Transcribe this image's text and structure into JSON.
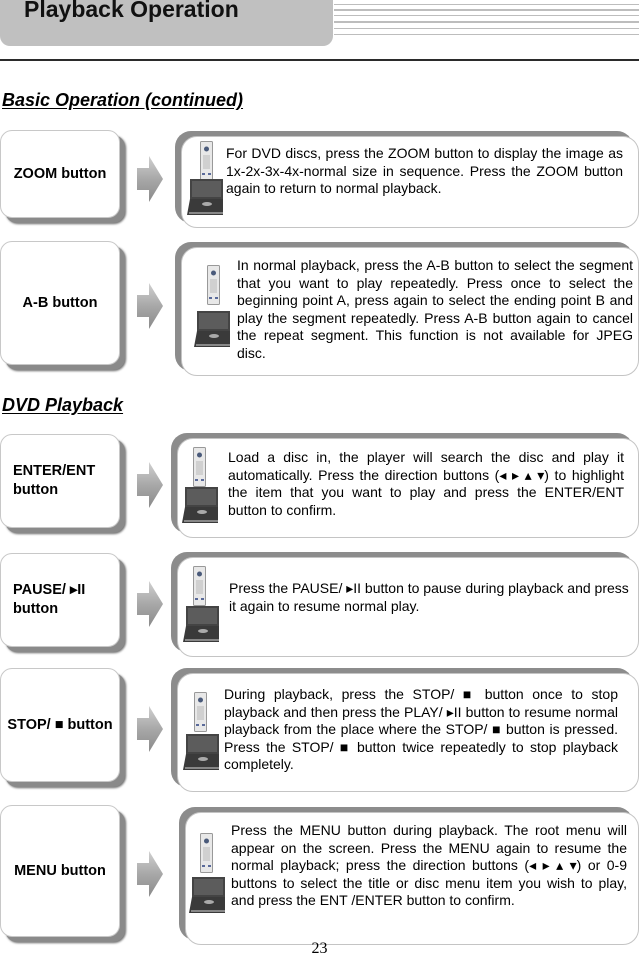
{
  "header": {
    "title": "Playback Operation"
  },
  "sections": [
    {
      "title": "Basic Operation (continued)"
    },
    {
      "title": "DVD Playback"
    }
  ],
  "rows": [
    {
      "label_lines": [
        "ZOOM button"
      ],
      "description": "For DVD discs, press the ZOOM button to display the image as 1x-2x-3x-4x-normal size in sequence. Press the ZOOM button again to return to normal playback."
    },
    {
      "label_lines": [
        "A-B button"
      ],
      "description": "In normal playback, press the A-B button to select the segment that you want to play repeatedly. Press once to select the beginning point A, press again to select the ending point B and play the segment repeatedly. Press A-B button again to cancel the repeat segment. This function is not available for JPEG disc."
    },
    {
      "label_lines": [
        "ENTER/ENT",
        "button"
      ],
      "description": "Load a disc in, the player will search the disc and play it automatically. Press the direction buttons (◂ ▸ ▴ ▾) to highlight the item that you want to play and press the ENTER/ENT button to confirm."
    },
    {
      "label_lines": [
        "PAUSE/ ▸II",
        "button"
      ],
      "description": "Press the PAUSE/ ▸II button to pause during playback and press it again to resume normal play."
    },
    {
      "label_lines": [
        "STOP/ ■  button"
      ],
      "description": "During playback, press the STOP/ ■ button once to stop playback and then press the PLAY/ ▸II button to resume normal playback from the place where the STOP/ ■ button is pressed. Press the STOP/ ■ button twice repeatedly to stop playback completely."
    },
    {
      "label_lines": [
        "MENU button"
      ],
      "description": "Press the MENU button during playback. The root menu will appear on the screen. Press the MENU again to resume the normal playback; press the direction buttons (◂ ▸ ▴ ▾) or 0-9 buttons to select the title or disc menu item you wish to play, and press the ENT /ENTER button to confirm."
    }
  ],
  "icons": {
    "remote": "remote-control-icon",
    "player": "portable-dvd-player-icon",
    "arrow": "right-arrow-icon"
  },
  "footer": {
    "page_number": "23"
  }
}
